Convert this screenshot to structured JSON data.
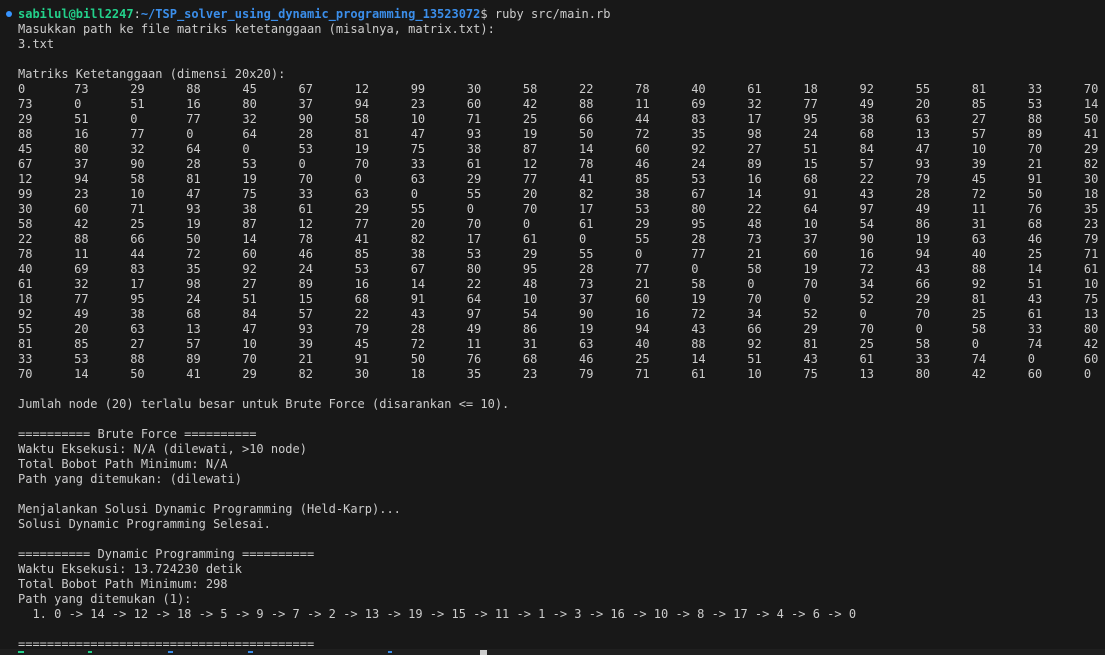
{
  "terminal": {
    "top_rule": "=========================================",
    "prompt": {
      "user_host": "sabilul@bill2247",
      "separator": ":",
      "path": "~/TSP_solver_using_dynamic_programming_13523072",
      "dollar": "$",
      "command": " ruby src/main.rb"
    },
    "input_prompt": "Masukkan path ke file matriks ketetanggaan (misalnya, matrix.txt):",
    "input_value": "3.txt",
    "matrix_title": "Matriks Ketetanggaan (dimensi 20x20):",
    "matrix": [
      [
        0,
        73,
        29,
        88,
        45,
        67,
        12,
        99,
        30,
        58,
        22,
        78,
        40,
        61,
        18,
        92,
        55,
        81,
        33,
        70
      ],
      [
        73,
        0,
        51,
        16,
        80,
        37,
        94,
        23,
        60,
        42,
        88,
        11,
        69,
        32,
        77,
        49,
        20,
        85,
        53,
        14
      ],
      [
        29,
        51,
        0,
        77,
        32,
        90,
        58,
        10,
        71,
        25,
        66,
        44,
        83,
        17,
        95,
        38,
        63,
        27,
        88,
        50
      ],
      [
        88,
        16,
        77,
        0,
        64,
        28,
        81,
        47,
        93,
        19,
        50,
        72,
        35,
        98,
        24,
        68,
        13,
        57,
        89,
        41
      ],
      [
        45,
        80,
        32,
        64,
        0,
        53,
        19,
        75,
        38,
        87,
        14,
        60,
        92,
        27,
        51,
        84,
        47,
        10,
        70,
        29
      ],
      [
        67,
        37,
        90,
        28,
        53,
        0,
        70,
        33,
        61,
        12,
        78,
        46,
        24,
        89,
        15,
        57,
        93,
        39,
        21,
        82
      ],
      [
        12,
        94,
        58,
        81,
        19,
        70,
        0,
        63,
        29,
        77,
        41,
        85,
        53,
        16,
        68,
        22,
        79,
        45,
        91,
        30
      ],
      [
        99,
        23,
        10,
        47,
        75,
        33,
        63,
        0,
        55,
        20,
        82,
        38,
        67,
        14,
        91,
        43,
        28,
        72,
        50,
        18
      ],
      [
        30,
        60,
        71,
        93,
        38,
        61,
        29,
        55,
        0,
        70,
        17,
        53,
        80,
        22,
        64,
        97,
        49,
        11,
        76,
        35
      ],
      [
        58,
        42,
        25,
        19,
        87,
        12,
        77,
        20,
        70,
        0,
        61,
        29,
        95,
        48,
        10,
        54,
        86,
        31,
        68,
        23
      ],
      [
        22,
        88,
        66,
        50,
        14,
        78,
        41,
        82,
        17,
        61,
        0,
        55,
        28,
        73,
        37,
        90,
        19,
        63,
        46,
        79
      ],
      [
        78,
        11,
        44,
        72,
        60,
        46,
        85,
        38,
        53,
        29,
        55,
        0,
        77,
        21,
        60,
        16,
        94,
        40,
        25,
        71
      ],
      [
        40,
        69,
        83,
        35,
        92,
        24,
        53,
        67,
        80,
        95,
        28,
        77,
        0,
        58,
        19,
        72,
        43,
        88,
        14,
        61
      ],
      [
        61,
        32,
        17,
        98,
        27,
        89,
        16,
        14,
        22,
        48,
        73,
        21,
        58,
        0,
        70,
        34,
        66,
        92,
        51,
        10
      ],
      [
        18,
        77,
        95,
        24,
        51,
        15,
        68,
        91,
        64,
        10,
        37,
        60,
        19,
        70,
        0,
        52,
        29,
        81,
        43,
        75
      ],
      [
        92,
        49,
        38,
        68,
        84,
        57,
        22,
        43,
        97,
        54,
        90,
        16,
        72,
        34,
        52,
        0,
        70,
        25,
        61,
        13
      ],
      [
        55,
        20,
        63,
        13,
        47,
        93,
        79,
        28,
        49,
        86,
        19,
        94,
        43,
        66,
        29,
        70,
        0,
        58,
        33,
        80
      ],
      [
        81,
        85,
        27,
        57,
        10,
        39,
        45,
        72,
        11,
        31,
        63,
        40,
        88,
        92,
        81,
        25,
        58,
        0,
        74,
        42
      ],
      [
        33,
        53,
        88,
        89,
        70,
        21,
        91,
        50,
        76,
        68,
        46,
        25,
        14,
        51,
        43,
        61,
        33,
        74,
        0,
        60
      ],
      [
        70,
        14,
        50,
        41,
        29,
        82,
        30,
        18,
        35,
        23,
        79,
        71,
        61,
        10,
        75,
        13,
        80,
        42,
        60,
        0
      ]
    ],
    "warning": "Jumlah node (20) terlalu besar untuk Brute Force (disarankan <= 10).",
    "bf_header": "========== Brute Force ==========",
    "bf_time": "Waktu Eksekusi: N/A (dilewati, >10 node)",
    "bf_cost": "Total Bobot Path Minimum: N/A",
    "bf_path": "Path yang ditemukan: (dilewati)",
    "dp_running": "Menjalankan Solusi Dynamic Programming (Held-Karp)...",
    "dp_done": "Solusi Dynamic Programming Selesai.",
    "dp_header": "========== Dynamic Programming ==========",
    "dp_time": "Waktu Eksekusi: 13.724230 detik",
    "dp_cost": "Total Bobot Path Minimum: 298",
    "dp_path_title": "Path yang ditemukan (1):",
    "dp_path_value": "  1. 0 -> 14 -> 12 -> 18 -> 5 -> 9 -> 7 -> 2 -> 13 -> 19 -> 15 -> 11 -> 1 -> 3 -> 16 -> 10 -> 8 -> 17 -> 4 -> 6 -> 0",
    "bottom_rule": "=========================================",
    "colors": {
      "background": "#181818",
      "text": "#cccccc",
      "prompt_user": "#23d18b",
      "prompt_path": "#3b8eea",
      "prompt_dot": "#3794ff"
    }
  }
}
